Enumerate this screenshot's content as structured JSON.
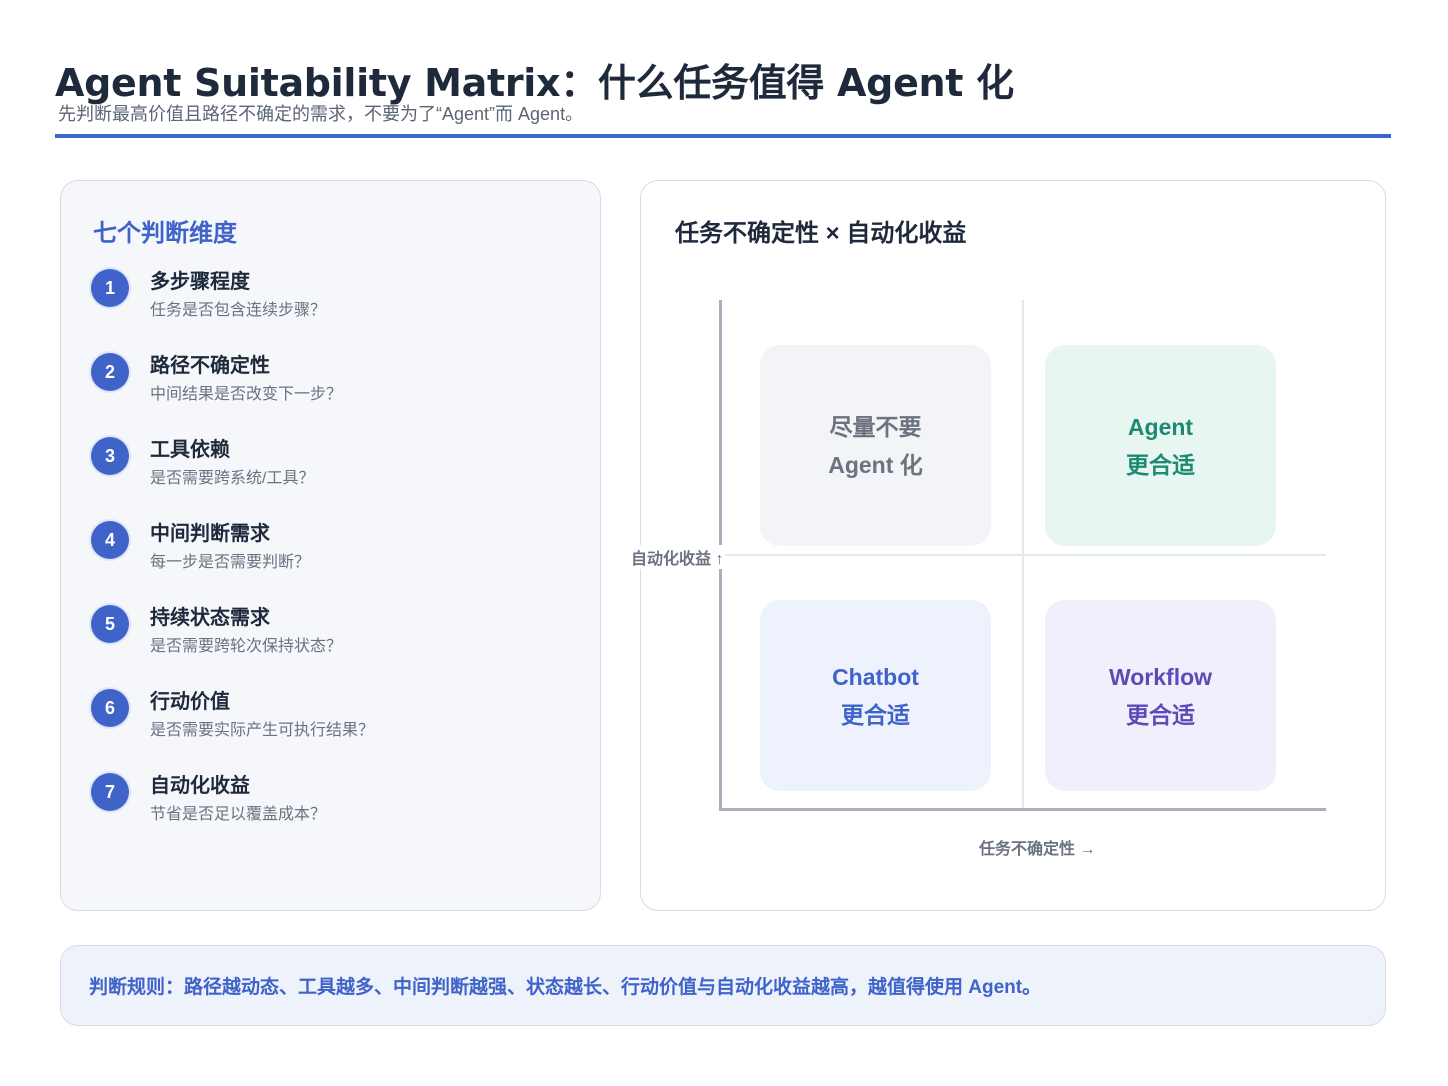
{
  "header": {
    "title": "Agent Suitability Matrix：什么任务值得 Agent 化",
    "subtitle": "先判断最高价值且路径不确定的需求，不要为了“Agent”而 Agent。"
  },
  "dimensions": {
    "heading": "七个判断维度",
    "items": [
      {
        "num": "1",
        "title": "多步骤程度",
        "desc": "任务是否包含连续步骤？"
      },
      {
        "num": "2",
        "title": "路径不确定性",
        "desc": "中间结果是否改变下一步？"
      },
      {
        "num": "3",
        "title": "工具依赖",
        "desc": "是否需要跨系统/工具？"
      },
      {
        "num": "4",
        "title": "中间判断需求",
        "desc": "每一步是否需要判断？"
      },
      {
        "num": "5",
        "title": "持续状态需求",
        "desc": "是否需要跨轮次保持状态？"
      },
      {
        "num": "6",
        "title": "行动价值",
        "desc": "是否需要实际产生可执行结果？"
      },
      {
        "num": "7",
        "title": "自动化收益",
        "desc": "节省是否足以覆盖成本？"
      }
    ]
  },
  "matrix": {
    "heading": "任务不确定性 × 自动化收益",
    "y_axis_label": "自动化收益 ↑",
    "x_axis_label": "任务不确定性 →",
    "quadrants": {
      "top_left": {
        "line1": "尽量不要",
        "line2": "Agent 化"
      },
      "top_right": {
        "line1": "Agent",
        "line2": "更合适"
      },
      "bottom_left": {
        "line1": "Chatbot",
        "line2": "更合适"
      },
      "bottom_right": {
        "line1": "Workflow",
        "line2": "更合适"
      }
    },
    "colors": {
      "top_left": "#6b7280",
      "top_right": "#1f8a72",
      "bottom_left": "#3f63c8",
      "bottom_right": "#5b4bb8"
    }
  },
  "footer": {
    "rule": "判断规则：路径越动态、工具越多、中间判断越强、状态越长、行动价值与自动化收益越高，越值得使用 Agent。"
  },
  "accent_color": "#3f63c8"
}
